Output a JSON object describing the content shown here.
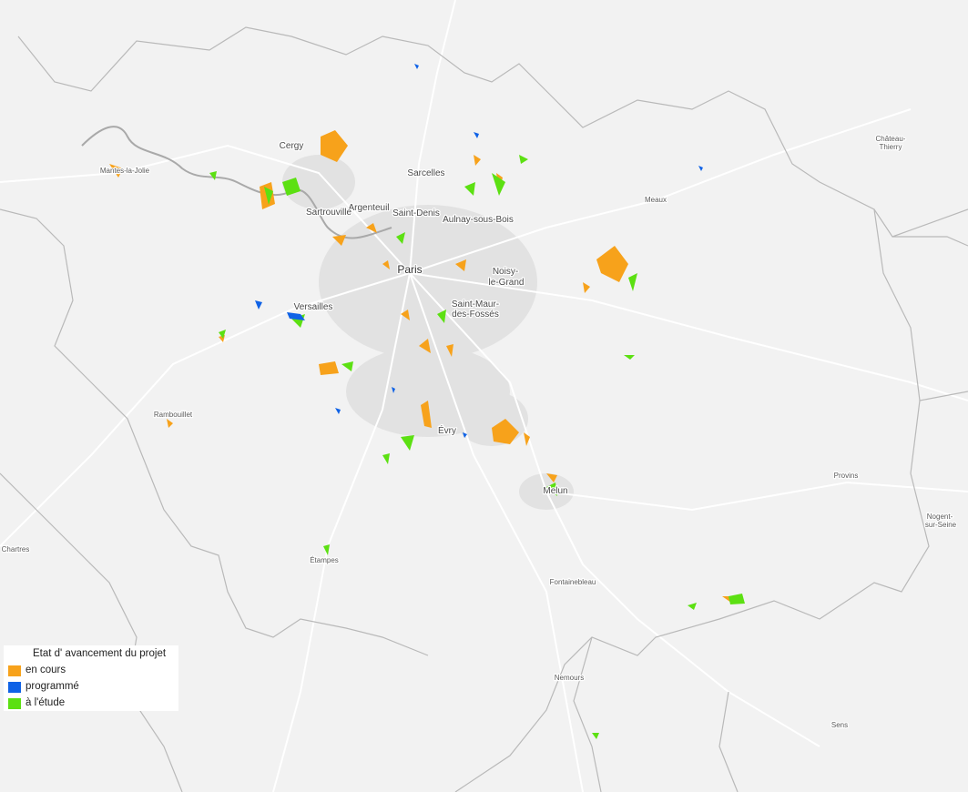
{
  "map": {
    "colors": {
      "background": "#f2f2f2",
      "boundary": "#b9b9b9",
      "roads": "#ffffff",
      "urban": "#e2e2e2",
      "river": "#a9a9a9"
    },
    "cities": {
      "paris": "Paris",
      "cergy": "Cergy",
      "mantes": "Mantes-la-Jolie",
      "sarcelles": "Sarcelles",
      "argenteuil": "Argenteuil",
      "sartrouville": "Sartrouville",
      "saint_denis": "Saint-Denis",
      "aulnay": "Aulnay-sous-Bois",
      "noisy_1": "Noisy-",
      "noisy_2": "le-Grand",
      "saint_maur_1": "Saint-Maur-",
      "saint_maur_2": "des-Fossés",
      "versailles": "Versailles",
      "meaux": "Meaux",
      "chateau_1": "Château-",
      "chateau_2": "Thierry",
      "rambouillet": "Rambouillet",
      "evry": "Évry",
      "melun": "Melun",
      "provins": "Provins",
      "nogent_1": "Nogent-",
      "nogent_2": "sur-Seine",
      "chartres": "Chartres",
      "etampes": "Étampes",
      "fontainebleau": "Fontainebleau",
      "nemours": "Nemours",
      "sens": "Sens"
    }
  },
  "legend": {
    "title": "Etat d' avancement du projet",
    "items": [
      {
        "label": "en cours",
        "color": "#f7a21b"
      },
      {
        "label": "programmé",
        "color": "#0f62e6"
      },
      {
        "label": "à l'étude",
        "color": "#5ce012"
      }
    ]
  }
}
